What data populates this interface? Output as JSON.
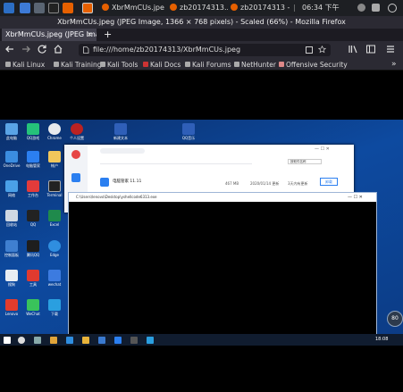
{
  "panel": {
    "tasks": [
      {
        "label": "XbrMmCUs.jpe"
      },
      {
        "label": "zb20174313..."
      },
      {
        "label": "zb20174313 - ..."
      }
    ],
    "time": "06:34 下午"
  },
  "browser": {
    "window_title": "XbrMmCUs.jpeg (JPEG Image, 1366 × 768 pixels) - Scaled (66%) - Mozilla Firefox",
    "tab_label": "XbrMmCUs.jpeg (JPEG Imag",
    "tab_close": "×",
    "new_tab": "+",
    "url": "file:///home/zb20174313/XbrMmCUs.jpeg",
    "bookmarks": [
      "Kali Linux",
      "Kali Training",
      "Kali Tools",
      "Kali Docs",
      "Kali Forums",
      "NetHunter",
      "Offensive Security"
    ],
    "overflow": "»"
  },
  "screenshot": {
    "desktop_icons": [
      {
        "label": "此电脑"
      },
      {
        "label": "QQ游戏"
      },
      {
        "label": "Chrome"
      },
      {
        "label": "个人设置"
      },
      {
        "label": "新建文本"
      },
      {
        "label": "QQ音乐"
      },
      {
        "label": "OneDrive"
      },
      {
        "label": "电脑管家"
      },
      {
        "label": "帐户"
      },
      {
        "label": "网络"
      },
      {
        "label": "工作台"
      },
      {
        "label": "Terminal"
      },
      {
        "label": "回收站"
      },
      {
        "label": "QQ"
      },
      {
        "label": "Excel"
      },
      {
        "label": "控制面板"
      },
      {
        "label": "腾讯QQ"
      },
      {
        "label": "Edge"
      },
      {
        "label": "搜狗"
      },
      {
        "label": "工具"
      },
      {
        "label": "wechat"
      },
      {
        "label": "Lenovo"
      },
      {
        "label": "WeChat"
      },
      {
        "label": "下载"
      }
    ],
    "app": {
      "title": "电脑管家 11.11",
      "row_size": "467 MB",
      "row_date": "2020/01/14 更新",
      "row_ver": "3天内有更新",
      "button": "卸载",
      "dropdown": "按软件名称"
    },
    "console_title": "C:\\Users\\lenovo\\Desktop\\yshellcode6313.exe",
    "speed": "80",
    "clock": "18:08"
  }
}
